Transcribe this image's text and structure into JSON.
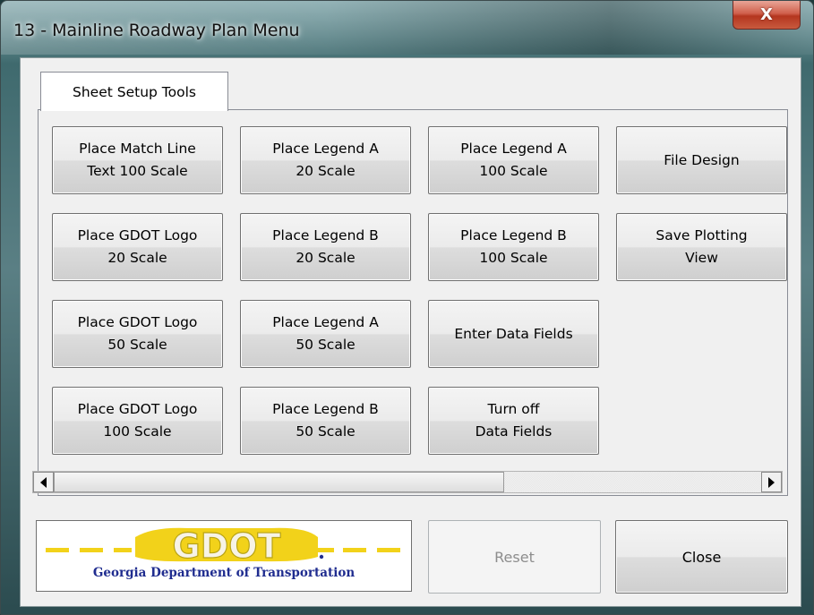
{
  "window": {
    "title": "13 - Mainline Roadway Plan Menu",
    "close_glyph": "X"
  },
  "tabs": [
    {
      "label": "Sheet Setup Tools",
      "active": true
    }
  ],
  "tools": [
    {
      "label": "Place Match Line\nText 100 Scale"
    },
    {
      "label": "Place Legend A\n20 Scale"
    },
    {
      "label": "Place Legend A\n100 Scale"
    },
    {
      "label": "File Design"
    },
    {
      "label": "Place GDOT Logo\n20 Scale"
    },
    {
      "label": "Place Legend B\n20 Scale"
    },
    {
      "label": "Place Legend B\n100 Scale"
    },
    {
      "label": "Save Plotting\nView"
    },
    {
      "label": "Place GDOT Logo\n50 Scale"
    },
    {
      "label": "Place Legend A\n50 Scale"
    },
    {
      "label": "Enter Data Fields"
    },
    {
      "label": "Place GDOT Logo\n100 Scale"
    },
    {
      "label": "Place Legend B\n50 Scale"
    },
    {
      "label": "Turn off\nData Fields"
    }
  ],
  "logo": {
    "wordmark": "GDOT",
    "caption": "Georgia Department of Transportation",
    "colors": {
      "yellow": "#f2d21a",
      "blue": "#1f2c8f"
    }
  },
  "buttons": {
    "reset": {
      "label": "Reset",
      "enabled": false
    },
    "close": {
      "label": "Close",
      "enabled": true
    }
  }
}
